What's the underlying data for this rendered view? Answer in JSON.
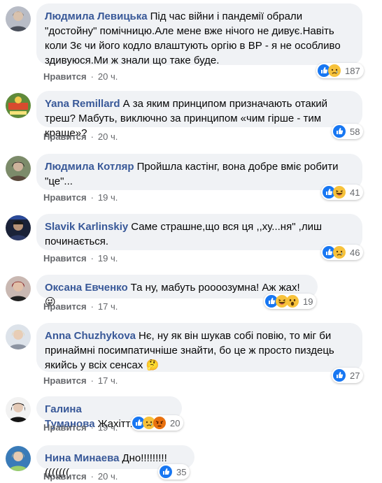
{
  "comments": [
    {
      "author": "Людмила Левицька",
      "text": "Під час війни і пандемії обрали \"достойну\" помічницю.Але мене вже нічого не дивує.Навіть коли Зє чи його кодло влаштують оргію в ВР - я не особливо здивуюся.Ми ж знали що таке буде.",
      "like": "Нравится",
      "time": "20 ч.",
      "reactions": [
        "like-icon",
        "sad-icon"
      ],
      "count": "187"
    },
    {
      "author": "Yana Remillard",
      "text": "А за яким принципом призначають отакий треш? Мабуть, виключно за принципом «чим гірше - тим краще»?",
      "like": "Нравится",
      "time": "20 ч.",
      "reactions": [
        "like-icon"
      ],
      "count": "58"
    },
    {
      "author": "Людмила Котляр",
      "text": "Пройшла кастінг, вона добре вміє робити \"це\"...",
      "like": "Нравится",
      "time": "19 ч.",
      "reactions": [
        "like-icon",
        "haha-icon"
      ],
      "count": "41"
    },
    {
      "author": "Slavik Karlinskiy",
      "text": "Саме страшне,що вся ця ,,ху...ня\" ,лиш починається.",
      "like": "Нравится",
      "time": "19 ч.",
      "reactions": [
        "like-icon",
        "sad-icon"
      ],
      "count": "46"
    },
    {
      "author": "Оксана Евченко",
      "text": "Та ну, мабуть роооозумна! Аж жах! 😜",
      "like": "Нравится",
      "time": "17 ч.",
      "reactions": [
        "like-icon",
        "haha-icon",
        "wow-icon"
      ],
      "count": "19"
    },
    {
      "author": "Anna Chuzhykova",
      "text": "Нє, ну як він шукав собі повію, то міг би принаймні посимпатичніше знайти, бо це ж просто пиздець якийсь у всіх сенсах 🤔",
      "like": "Нравится",
      "time": "17 ч.",
      "reactions": [
        "like-icon"
      ],
      "count": "27"
    },
    {
      "author": "Галина Туманова",
      "text": "Жахіття!",
      "like": "Нравится",
      "time": "19 ч.",
      "reactions": [
        "like-icon",
        "sad-icon",
        "angry-icon"
      ],
      "count": "20"
    },
    {
      "author": "Нина Минаева",
      "text": "Дно!!!!!!!!!(((((((",
      "like": "Нравится",
      "time": "20 ч.",
      "reactions": [
        "like-icon"
      ],
      "count": "35"
    }
  ],
  "colors": {
    "author": "#385898",
    "bubble": "#f0f2f5",
    "meta": "#65676b",
    "like": "#1877f2"
  }
}
